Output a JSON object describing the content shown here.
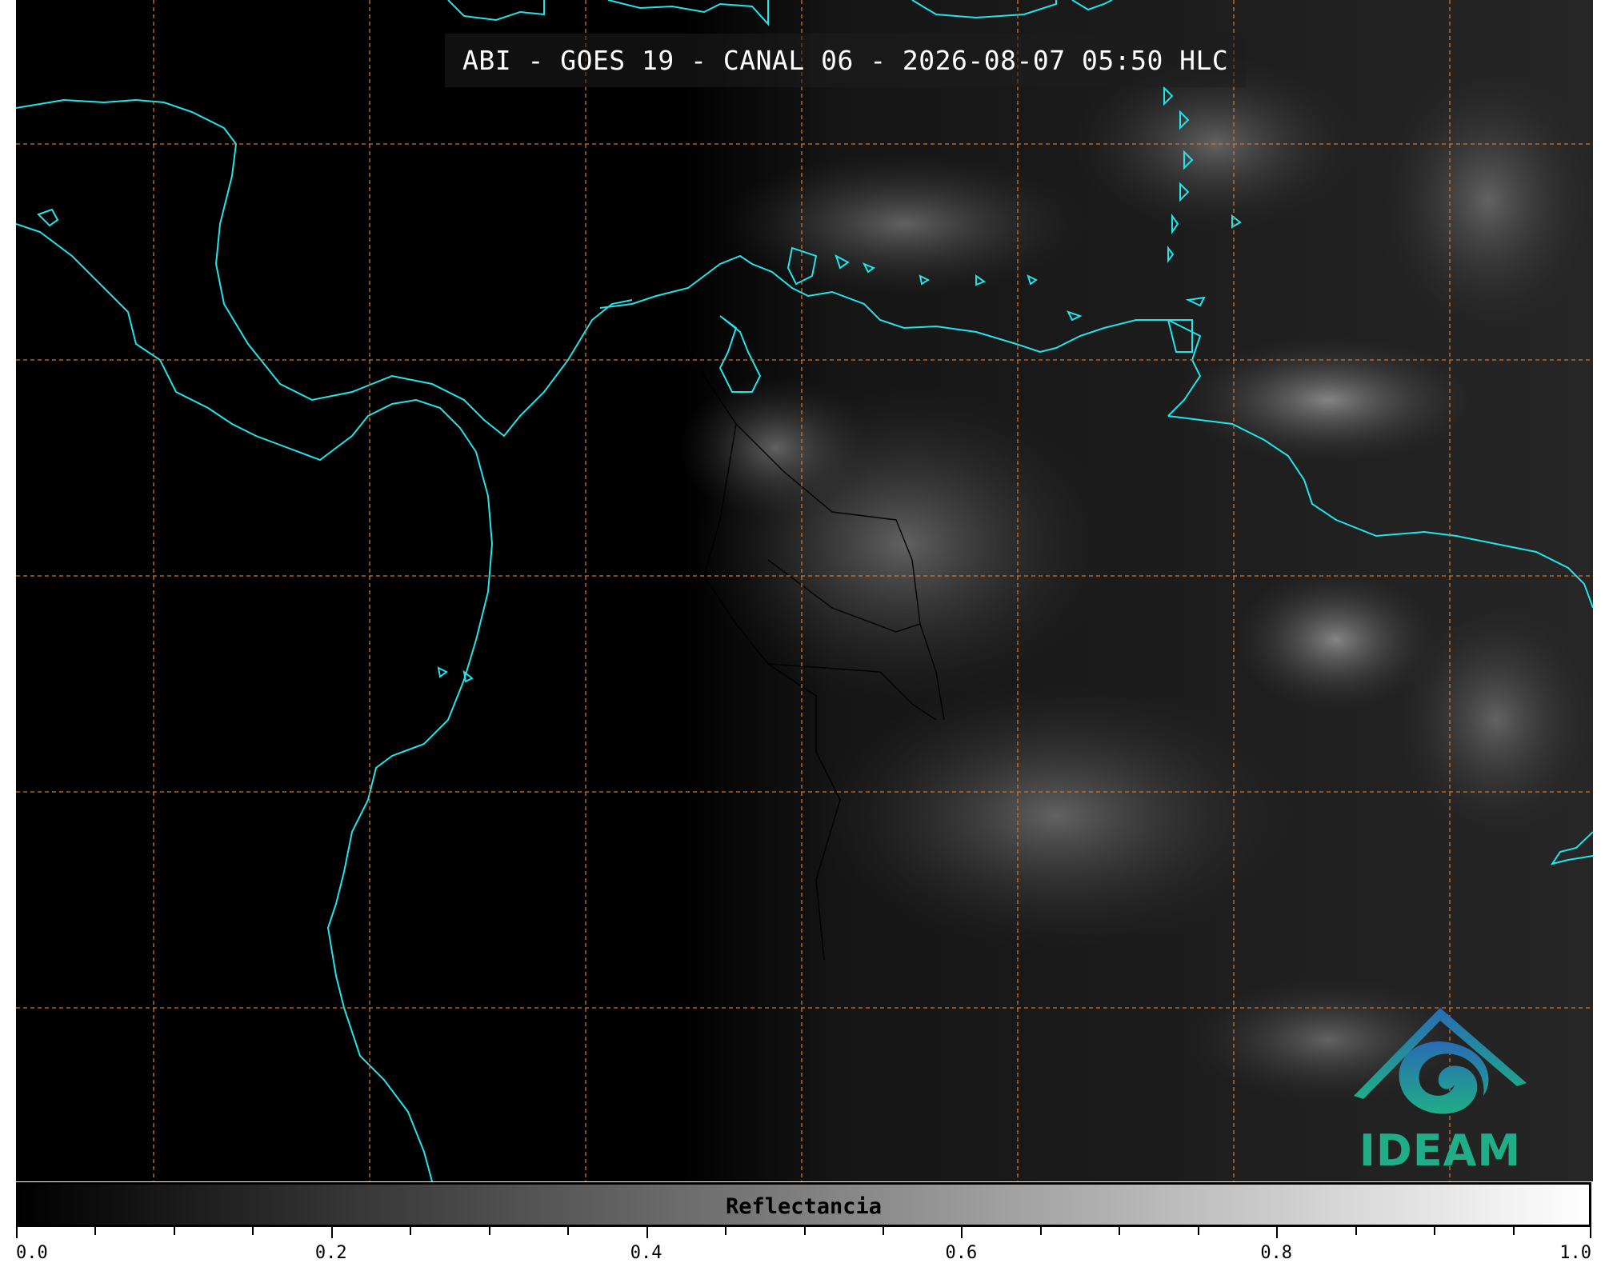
{
  "title": "ABI - GOES 19 - CANAL 06 - 2026-08-07 05:50 HLC",
  "logo": {
    "text": "IDEAM",
    "icon": "ideam-logo-icon"
  },
  "colorbar": {
    "label": "Reflectancia",
    "range": [
      0.0,
      1.0
    ],
    "colormap": "grayscale",
    "major_ticks": [
      "0.0",
      "0.2",
      "0.4",
      "0.6",
      "0.8",
      "1.0"
    ],
    "minor_tick_step": 0.05
  },
  "colors": {
    "coastline": "#22e5ea",
    "gridline": "#d2752a",
    "borders": "#000000",
    "logo_green": "#1fae86",
    "logo_blue": "#2a6bb5"
  }
}
